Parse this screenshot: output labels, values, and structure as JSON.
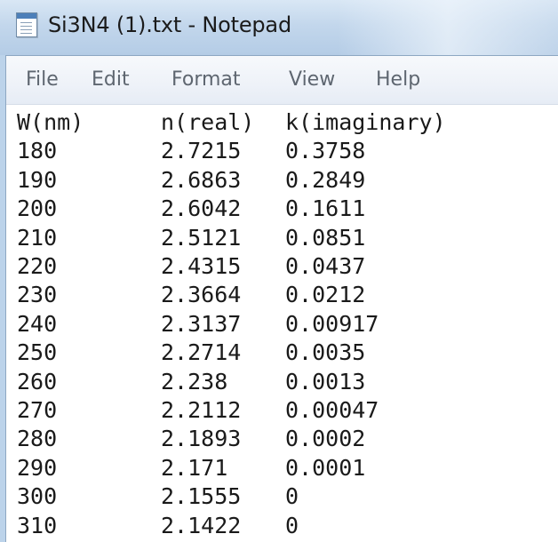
{
  "window": {
    "title": "Si3N4 (1).txt - Notepad",
    "icon": "notepad-icon"
  },
  "menu": [
    "File",
    "Edit",
    "Format",
    "View",
    "Help"
  ],
  "document": {
    "header": [
      "W(nm)",
      "n(real)",
      "k(imaginary)"
    ],
    "rows": [
      [
        "180",
        "2.7215",
        "0.3758"
      ],
      [
        "190",
        "2.6863",
        "0.2849"
      ],
      [
        "200",
        "2.6042",
        "0.1611"
      ],
      [
        "210",
        "2.5121",
        "0.0851"
      ],
      [
        "220",
        "2.4315",
        "0.0437"
      ],
      [
        "230",
        "2.3664",
        "0.0212"
      ],
      [
        "240",
        "2.3137",
        "0.00917"
      ],
      [
        "250",
        "2.2714",
        "0.0035"
      ],
      [
        "260",
        "2.238",
        "0.0013"
      ],
      [
        "270",
        "2.2112",
        "0.00047"
      ],
      [
        "280",
        "2.1893",
        "0.0002"
      ],
      [
        "290",
        "2.171",
        "0.0001"
      ],
      [
        "300",
        "2.1555",
        "0"
      ],
      [
        "310",
        "2.1422",
        "0"
      ]
    ]
  }
}
